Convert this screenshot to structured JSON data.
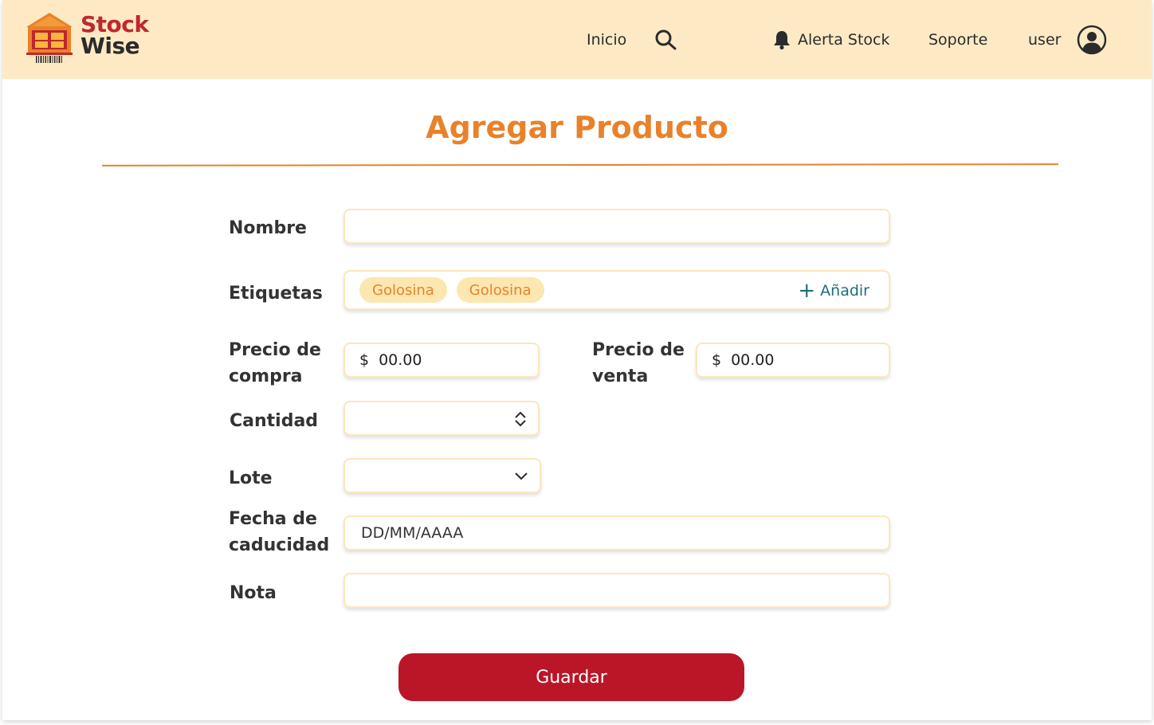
{
  "header": {
    "brand_line1": "Stock",
    "brand_line2": "Wise",
    "nav_inicio": "Inicio",
    "search_icon": "search-icon",
    "nav_alert": "Alerta Stock",
    "nav_soporte": "Soporte",
    "nav_user": "user",
    "avatar_icon": "user-circle-icon"
  },
  "colors": {
    "header_bg": "#fdeac5",
    "accent_orange": "#e8822a",
    "brand_red": "#c0272d",
    "save_button": "#ba1628",
    "chip_bg": "#fde7b0",
    "add_link": "#1f6d7a"
  },
  "page": {
    "title": "Agregar Producto"
  },
  "form": {
    "nombre_label": "Nombre",
    "nombre_value": "",
    "etiquetas_label": "Etiquetas",
    "tags": [
      "Golosina",
      "Golosina"
    ],
    "add_label": "Añadir",
    "precio_compra_label_1": "Precio de",
    "precio_compra_label_2": "compra",
    "precio_compra_currency": "$",
    "precio_compra_value": "00.00",
    "precio_venta_label_1": "Precio de",
    "precio_venta_label_2": "venta",
    "precio_venta_currency": "$",
    "precio_venta_value": "00.00",
    "cantidad_label": "Cantidad",
    "cantidad_value": "",
    "lote_label": "Lote",
    "lote_value": "",
    "fecha_label_1": "Fecha de",
    "fecha_label_2": "caducidad",
    "fecha_placeholder": "DD/MM/AAAA",
    "nota_label": "Nota",
    "nota_value": "",
    "save_label": "Guardar"
  }
}
